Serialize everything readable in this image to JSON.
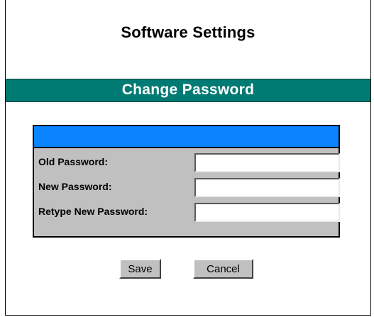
{
  "page": {
    "title": "Software Settings",
    "section_title": "Change Password"
  },
  "form": {
    "fields": [
      {
        "label": "Old Password:",
        "value": ""
      },
      {
        "label": "New Password:",
        "value": ""
      },
      {
        "label": "Retype New Password:",
        "value": ""
      }
    ]
  },
  "actions": {
    "save_label": "Save",
    "cancel_label": "Cancel"
  },
  "colors": {
    "section_bar": "#007b74",
    "form_header": "#0b84ff",
    "form_panel": "#c0c0c0"
  }
}
